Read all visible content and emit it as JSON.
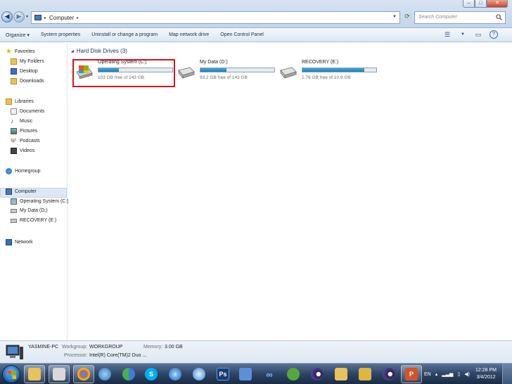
{
  "window": {
    "title": "",
    "controls": {
      "minimize": "–",
      "maximize": "□",
      "close": "✕"
    }
  },
  "address_bar": {
    "location": "Computer",
    "separator": "▸",
    "search_placeholder": "Search Computer"
  },
  "toolbar": {
    "organize": "Organize ▾",
    "system_properties": "System properties",
    "uninstall": "Uninstall or change a program",
    "map_drive": "Map network drive",
    "control_panel": "Open Control Panel"
  },
  "nav_pane": {
    "favorites": "Favorites",
    "favorites_items": [
      "My Folders",
      "Desktop",
      "Downloads"
    ],
    "libraries": "Libraries",
    "libraries_items": [
      "Documents",
      "Music",
      "Pictures",
      "Podcasts",
      "Videos"
    ],
    "homegroup": "Homegroup",
    "computer": "Computer",
    "computer_items": [
      "Operating System (C:)",
      "My Data (D:)",
      "RECOVERY (E:)"
    ],
    "network": "Network"
  },
  "content": {
    "group_title": "Hard Disk Drives (3)",
    "drives": [
      {
        "name": "Operating System (C:)",
        "free": "103 GB free of 143 GB",
        "used_fraction": 0.28
      },
      {
        "name": "My Data (D:)",
        "free": "93.2 GB free of 143 GB",
        "used_fraction": 0.35
      },
      {
        "name": "RECOVERY (E:)",
        "free": "1.76 GB free of 10.9 GB",
        "used_fraction": 0.84
      }
    ]
  },
  "details": {
    "computer_name": "YASMINE-PC",
    "workgroup_label": "Workgroup:",
    "workgroup_value": "WORKGROUP",
    "memory_label": "Memory:",
    "memory_value": "3.00 GB",
    "processor_label": "Processor:",
    "processor_value": "Intel(R) Core(TM)2 Duo ..."
  },
  "taskbar": {
    "language": "EN",
    "time": "12:28 PM",
    "date": "3/4/2012"
  },
  "colors": {
    "drive_bar_fill": "#1f7fb5",
    "highlight_border": "#d4141a",
    "taskbar": "#2d4566"
  }
}
